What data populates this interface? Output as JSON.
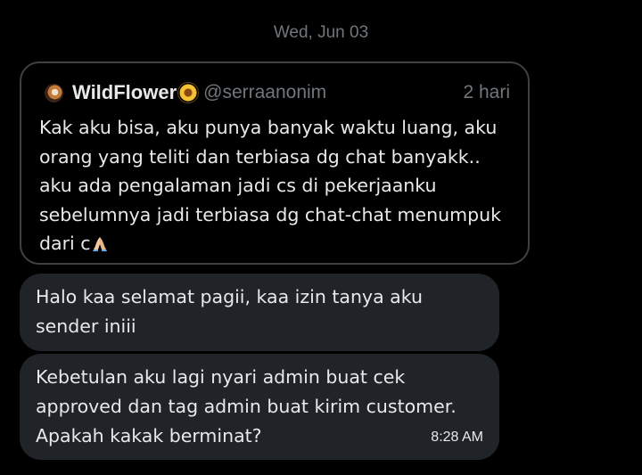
{
  "conversation": {
    "date_separator": "Wed, Jun 03"
  },
  "quoted_post": {
    "display_name": "WildFlower",
    "name_emoji": "sunflower-icon",
    "handle": "@serraanonim",
    "time": "2 hari",
    "text_lines": [
      "Kak aku bisa, aku punya banyak waktu luang, aku",
      "orang yang teliti dan terbiasa dg chat banyakk..",
      "aku ada pengalaman jadi cs di pekerjaanku",
      "sebelumnya jadi terbiasa dg chat-chat menumpuk",
      "dari c"
    ],
    "trailing_emoji": "folded-hands-icon"
  },
  "messages": [
    {
      "text_lines": [
        "Halo kaa selamat pagii, kaa izin tanya aku",
        "sender iniii"
      ]
    },
    {
      "text_lines": [
        "Kebetulan aku lagi nyari admin buat cek",
        "approved dan tag admin buat kirim customer.",
        "Apakah kakak berminat?"
      ],
      "time": "8:28 AM"
    }
  ],
  "colors": {
    "background": "#000000",
    "bubble": "#202327",
    "border": "#3e4144",
    "secondary_text": "#71767b",
    "primary_text": "#e7e9ea"
  }
}
